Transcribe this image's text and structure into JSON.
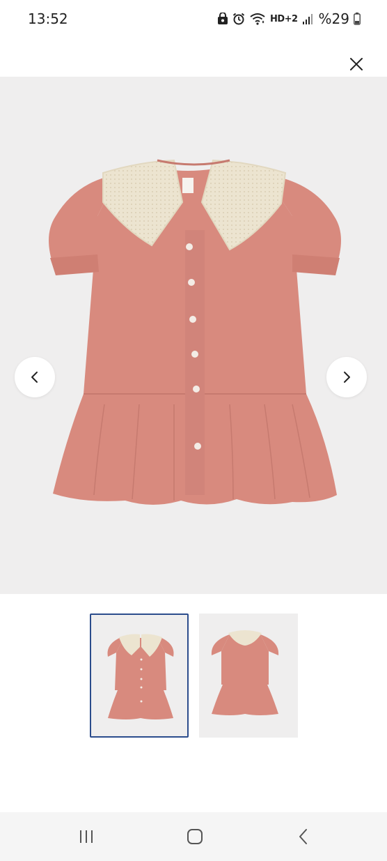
{
  "status_bar": {
    "time": "13:52",
    "network_label": "HD+2",
    "battery_percent": "%29",
    "icons": [
      "lock-icon",
      "alarm-icon",
      "wifi-icon",
      "hd-voice-icon",
      "signal-icon",
      "battery-icon"
    ]
  },
  "header": {
    "close_icon": "close-icon"
  },
  "gallery": {
    "current_index": 0,
    "prev_icon": "chevron-left-icon",
    "next_icon": "chevron-right-icon",
    "thumbnails": [
      {
        "view": "front",
        "selected": true
      },
      {
        "view": "back",
        "selected": false
      }
    ]
  },
  "product": {
    "dress_color": "#d88a7e",
    "collar_color": "#ece4d0"
  },
  "system_nav": {
    "recents_icon": "recents-icon",
    "home_icon": "home-icon",
    "back_icon": "back-icon"
  }
}
